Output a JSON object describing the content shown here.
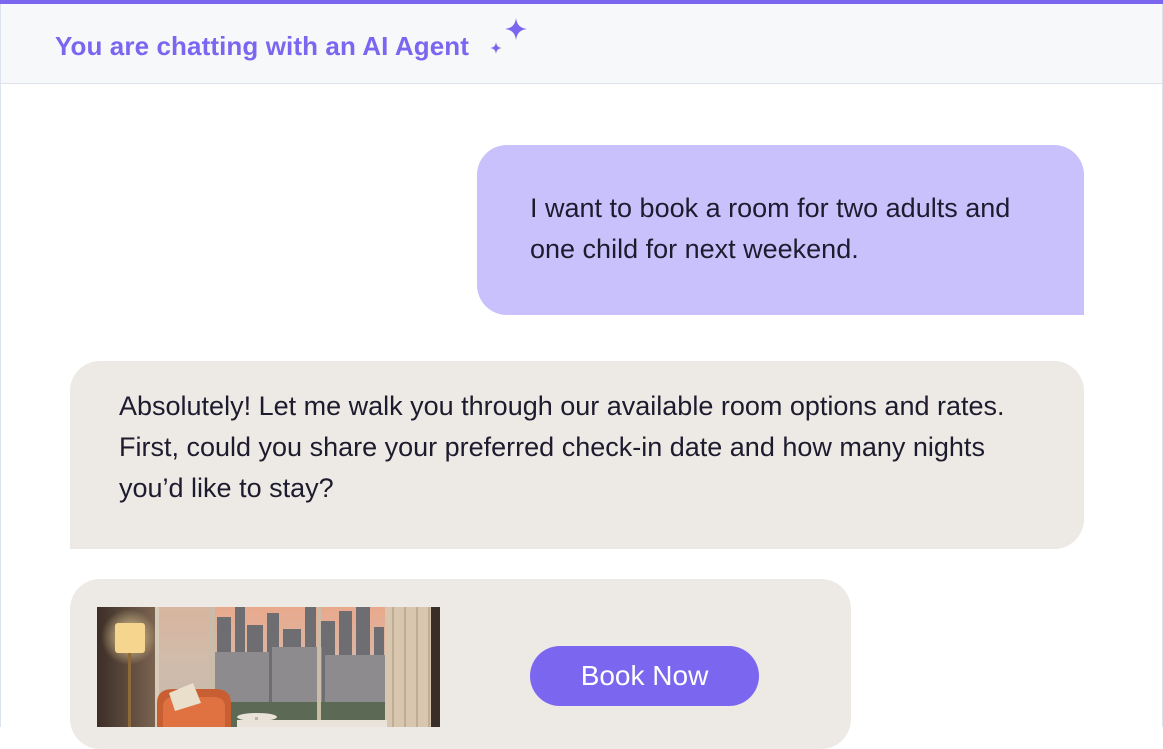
{
  "header": {
    "title": "You are chatting with an AI Agent",
    "icon": "sparkles-icon",
    "accent_color": "#7B66F0"
  },
  "messages": [
    {
      "role": "user",
      "text": "I want to book a room for two adults and one child for next weekend.",
      "bubble_color": "#C9C1FB"
    },
    {
      "role": "agent",
      "text": "Absolutely! Let me walk you through our available room options and rates. First, could you share your preferred check-in date and how many nights you’d like to stay?",
      "bubble_color": "#EDE9E4"
    }
  ],
  "room_card": {
    "image": "hotel-room-city-view-image",
    "button_label": "Book Now",
    "button_color": "#7B66F0"
  }
}
